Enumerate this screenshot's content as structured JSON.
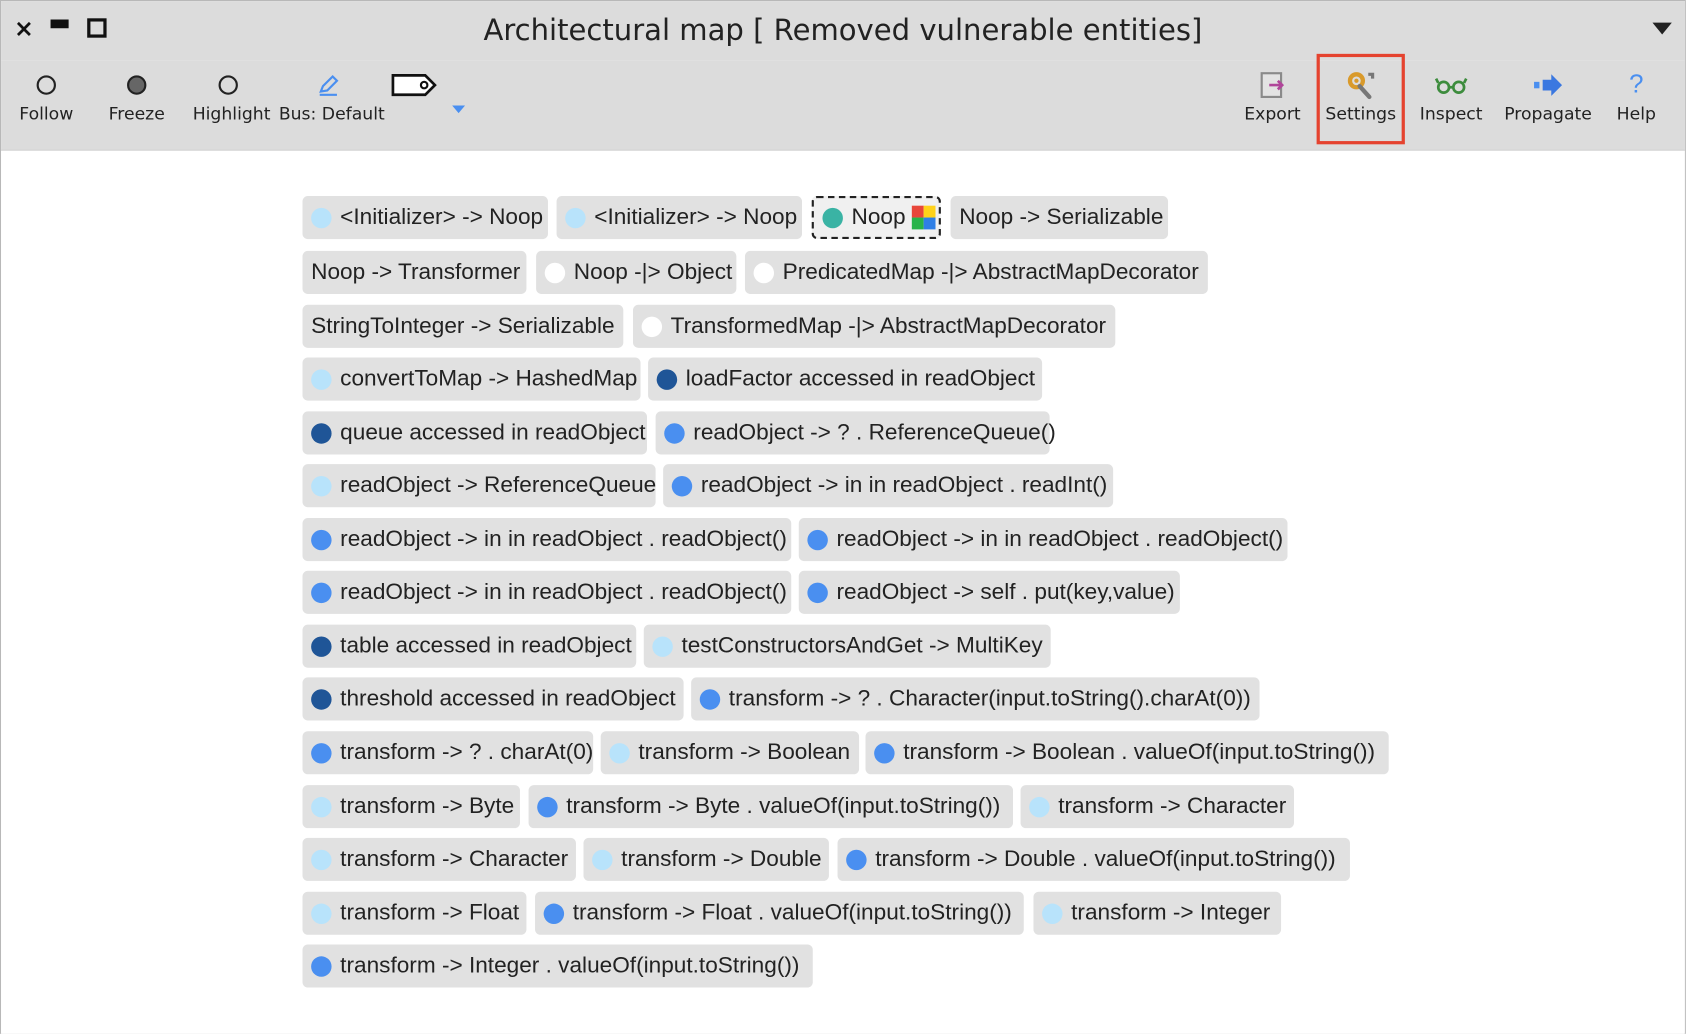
{
  "window": {
    "title": "Architectural map [ Removed vulnerable entities]",
    "controls": {
      "close": "×",
      "minimize": "▬"
    }
  },
  "toolbar": {
    "follow": "Follow",
    "freeze": "Freeze",
    "highlight": "Highlight",
    "bus": "Bus: Default",
    "export": "Export",
    "settings": "Settings",
    "inspect": "Inspect",
    "propagate": "Propagate",
    "help": "Help",
    "help_glyph": "?"
  },
  "colors": {
    "light_blue": "#b8e3fb",
    "blue": "#4a8ff0",
    "dark_blue": "#1f5597",
    "teal": "#3ab3a4",
    "white_dot": "#ffffff",
    "node_bg": "#e1e1e1",
    "highlight_box": "#e5432f"
  },
  "nodes": [
    {
      "label": "<Initializer> -> Noop",
      "dot": "light_blue"
    },
    {
      "label": "<Initializer> -> Noop",
      "dot": "light_blue"
    },
    {
      "label": "Noop",
      "dot": "teal",
      "selected": true
    },
    {
      "label": "Noop -> Serializable",
      "dot": "none"
    },
    {
      "label": "Noop -> Transformer",
      "dot": "none"
    },
    {
      "label": "Noop -|> Object",
      "dot": "white"
    },
    {
      "label": "PredicatedMap -|> AbstractMapDecorator",
      "dot": "white"
    },
    {
      "label": "StringToInteger -> Serializable",
      "dot": "none"
    },
    {
      "label": "TransformedMap -|> AbstractMapDecorator",
      "dot": "white"
    },
    {
      "label": "convertToMap -> HashedMap",
      "dot": "light_blue"
    },
    {
      "label": "loadFactor accessed in readObject",
      "dot": "dark_blue"
    },
    {
      "label": "queue accessed in readObject",
      "dot": "dark_blue"
    },
    {
      "label": "readObject -> ? . ReferenceQueue()",
      "dot": "blue"
    },
    {
      "label": "readObject -> ReferenceQueue",
      "dot": "light_blue"
    },
    {
      "label": "readObject -> in in readObject . readInt()",
      "dot": "blue"
    },
    {
      "label": "readObject -> in in readObject . readObject()",
      "dot": "blue"
    },
    {
      "label": "readObject -> in in readObject . readObject()",
      "dot": "blue"
    },
    {
      "label": "readObject -> in in readObject . readObject()",
      "dot": "blue"
    },
    {
      "label": "readObject -> self . put(key,value)",
      "dot": "blue"
    },
    {
      "label": "table accessed in readObject",
      "dot": "dark_blue"
    },
    {
      "label": "testConstructorsAndGet -> MultiKey",
      "dot": "light_blue"
    },
    {
      "label": "threshold accessed in readObject",
      "dot": "dark_blue"
    },
    {
      "label": "transform -> ? . Character(input.toString().charAt(0))",
      "dot": "blue"
    },
    {
      "label": "transform -> ? . charAt(0)",
      "dot": "blue"
    },
    {
      "label": "transform -> Boolean",
      "dot": "light_blue"
    },
    {
      "label": "transform -> Boolean . valueOf(input.toString())",
      "dot": "blue"
    },
    {
      "label": "transform -> Byte",
      "dot": "light_blue"
    },
    {
      "label": "transform -> Byte . valueOf(input.toString())",
      "dot": "blue"
    },
    {
      "label": "transform -> Character",
      "dot": "light_blue"
    },
    {
      "label": "transform -> Character",
      "dot": "light_blue"
    },
    {
      "label": "transform -> Double",
      "dot": "light_blue"
    },
    {
      "label": "transform -> Double . valueOf(input.toString())",
      "dot": "blue"
    },
    {
      "label": "transform -> Float",
      "dot": "light_blue"
    },
    {
      "label": "transform -> Float . valueOf(input.toString())",
      "dot": "blue"
    },
    {
      "label": "transform -> Integer",
      "dot": "light_blue"
    },
    {
      "label": "transform -> Integer . valueOf(input.toString())",
      "dot": "blue"
    }
  ]
}
